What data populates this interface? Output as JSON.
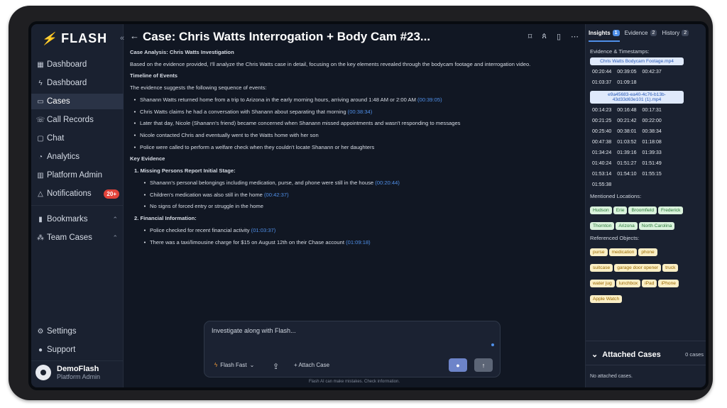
{
  "app": {
    "name": "FLASH"
  },
  "sidebar": {
    "items": [
      {
        "label": "Dashboard",
        "icon": "grid-icon"
      },
      {
        "label": "Dashboard",
        "icon": "bolt-icon"
      },
      {
        "label": "Cases",
        "icon": "folder-icon",
        "active": true
      },
      {
        "label": "Call Records",
        "icon": "phone-icon"
      },
      {
        "label": "Chat",
        "icon": "chat-icon"
      },
      {
        "label": "Analytics",
        "icon": "pie-icon"
      },
      {
        "label": "Platform Admin",
        "icon": "building-icon"
      },
      {
        "label": "Notifications",
        "icon": "bell-icon",
        "badge": "20+"
      },
      {
        "label": "Bookmarks",
        "icon": "bookmark-icon"
      },
      {
        "label": "Team Cases",
        "icon": "team-icon"
      }
    ],
    "footer": [
      {
        "label": "Settings",
        "icon": "gear-icon"
      },
      {
        "label": "Support",
        "icon": "support-icon"
      }
    ],
    "user": {
      "name": "DemoFlash",
      "role": "Platform Admin"
    }
  },
  "header": {
    "title": "Case: Chris Watts Interrogation + Body Cam #23..."
  },
  "analysis": {
    "heading": "Case Analysis: Chris Watts Investigation",
    "intro": "Based on the evidence provided, I'll analyze the Chris Watts case in detail, focusing on the key elements revealed through the bodycam footage and interrogation video.",
    "timeline_heading": "Timeline of Events",
    "timeline_intro": "The evidence suggests the following sequence of events:",
    "timeline": [
      {
        "text": "Shanann Watts returned home from a trip to Arizona in the early morning hours, arriving around 1:48 AM or 2:00 AM ",
        "ts": "(00:39:05)"
      },
      {
        "text": "Chris Watts claims he had a conversation with Shanann about separating that morning ",
        "ts": "(00:38:34)"
      },
      {
        "text": "Later that day, Nicole (Shanann's friend) became concerned when Shanann missed appointments and wasn't responding to messages",
        "ts": ""
      },
      {
        "text": "Nicole contacted Chris and eventually went to the Watts home with her son",
        "ts": ""
      },
      {
        "text": "Police were called to perform a welfare check when they couldn't locate Shanann or her daughters",
        "ts": ""
      }
    ],
    "key_heading": "Key Evidence",
    "key_1_heading": "1. Missing Persons Report Initial Stage:",
    "key_1": [
      {
        "text": "Shanann's personal belongings including medication, purse, and phone were still in the house ",
        "ts": "(00:20:44)"
      },
      {
        "text": "Children's medication was also still in the home ",
        "ts": "(00:42:37)"
      },
      {
        "text": "No signs of forced entry or struggle in the home",
        "ts": ""
      }
    ],
    "key_2_heading": "2. Financial Information:",
    "key_2": [
      {
        "text": "Police checked for recent financial activity ",
        "ts": "(01:03:37)"
      },
      {
        "text": "There was a taxi/limousine charge for $15 on August 12th on their Chase account ",
        "ts": "(01:09:18)"
      }
    ]
  },
  "composer": {
    "placeholder": "Investigate along with Flash...",
    "model": "Flash Fast",
    "attach": "+ Attach Case",
    "disclaimer": "Flash AI can make mistakes. Check information."
  },
  "right_panel": {
    "tabs": [
      {
        "label": "Insights",
        "count": "1",
        "active": true
      },
      {
        "label": "Evidence",
        "count": "2"
      },
      {
        "label": "History",
        "count": "2"
      }
    ],
    "evidence_heading": "Evidence & Timestamps:",
    "file1": "Chris Watts Bodycam Footage.mp4",
    "times1": [
      "00:20:44",
      "00:39:05",
      "00:42:37",
      "01:03:37",
      "01:09:18"
    ],
    "file2": "e9a45683-ea40-4c76-b13b-43d33d63e101 (1).mp4",
    "times2": [
      "00:14:23",
      "00:16:48",
      "00:17:31",
      "00:21:25",
      "00:21:42",
      "00:22:00",
      "00:25:40",
      "00:38:01",
      "00:38:34",
      "00:47:38",
      "01:03:52",
      "01:18:08",
      "01:34:24",
      "01:39:16",
      "01:39:33",
      "01:40:24",
      "01:51:27",
      "01:51:49",
      "01:53:14",
      "01:54:10",
      "01:55:15",
      "01:55:38"
    ],
    "locations_heading": "Mentioned Locations:",
    "locations": [
      "Hudson",
      "Erie",
      "Broomfield",
      "Frederick",
      "Thornton",
      "Arizona",
      "North Carolina"
    ],
    "objects_heading": "Referenced Objects:",
    "objects": [
      "purse",
      "medication",
      "phone",
      "suitcase",
      "garage door opener",
      "truck",
      "water jug",
      "lunchbox",
      "iPad",
      "iPhone",
      "Apple Watch"
    ],
    "attached_title": "Attached Cases",
    "attached_count": "0 cases",
    "attached_empty": "No attached cases."
  },
  "colors": {
    "accent": "#4f8fe8",
    "badge": "#e2433a",
    "sidebar": "#1a2130",
    "main": "#111723"
  }
}
